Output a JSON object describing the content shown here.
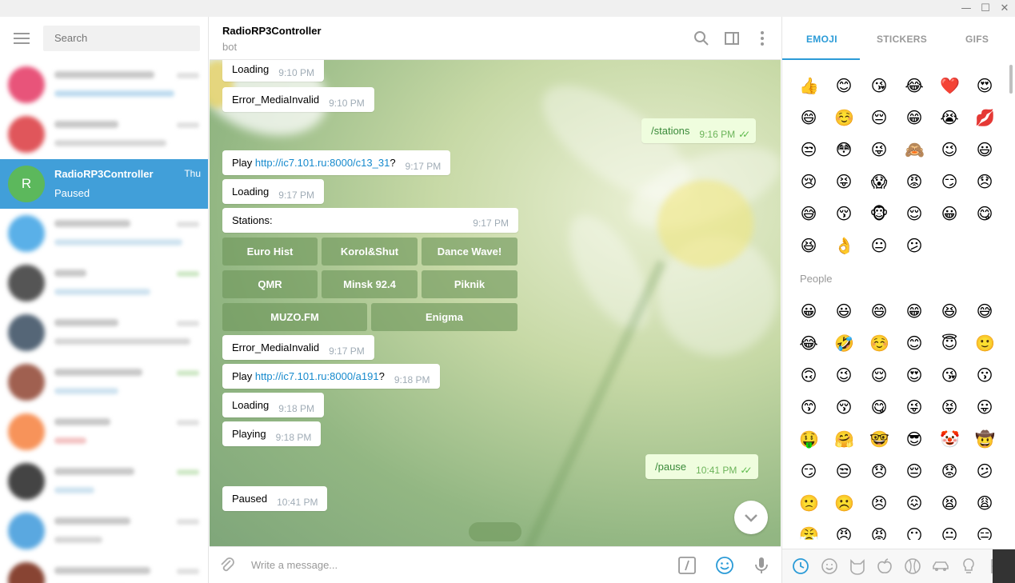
{
  "window": {
    "minimize": "—",
    "maximize": "☐",
    "close": "✕"
  },
  "sidebar": {
    "search_placeholder": "Search",
    "active_chat": {
      "avatar_letter": "R",
      "name": "RadioRP3Controller",
      "status": "Paused",
      "day": "Thu"
    },
    "blurred_avatar_colors": [
      "#e8547a",
      "#e0565b",
      "#5ab0e8",
      "#555555",
      "#556677",
      "#a06050",
      "#f7935a",
      "#444444",
      "#5aa8e0",
      "#884433"
    ]
  },
  "header": {
    "title": "RadioRP3Controller",
    "subtitle": "bot"
  },
  "messages": [
    {
      "text": "Loading",
      "time": "9:10 PM"
    },
    {
      "text": "Error_MediaInvalid",
      "time": "9:10 PM"
    },
    {
      "text": "/stations",
      "time": "9:16 PM",
      "outgoing": true
    },
    {
      "prefix": "Play ",
      "link": "http://ic7.101.ru:8000/c13_31",
      "suffix": "?",
      "time": "9:17 PM"
    },
    {
      "text": "Loading",
      "time": "9:17 PM"
    },
    {
      "text": "Stations:",
      "time": "9:17 PM"
    },
    {
      "text": "Error_MediaInvalid",
      "time": "9:17 PM"
    },
    {
      "prefix": "Play ",
      "link": "http://ic7.101.ru:8000/a191",
      "suffix": "?",
      "time": "9:18 PM"
    },
    {
      "text": "Loading",
      "time": "9:18 PM"
    },
    {
      "text": "Playing",
      "time": "9:18 PM"
    },
    {
      "text": "/pause",
      "time": "10:41 PM",
      "outgoing": true
    },
    {
      "text": "Paused",
      "time": "10:41 PM"
    }
  ],
  "keyboard": [
    "Euro Hist",
    "Korol&Shut",
    "Dance Wave!",
    "QMR",
    "Minsk 92.4",
    "Piknik",
    "MUZO.FM",
    "Enigma"
  ],
  "input": {
    "placeholder": "Write a message..."
  },
  "emoji_panel": {
    "tabs": [
      "EMOJI",
      "STICKERS",
      "GIFS"
    ],
    "active_tab": "EMOJI",
    "recent": [
      "👍",
      "😊",
      "😘",
      "😂",
      "❤️",
      "😍",
      "😄",
      "☺️",
      "😔",
      "😁",
      "😭",
      "💋",
      "😒",
      "😳",
      "😜",
      "🙈",
      "😉",
      "😃",
      "😢",
      "😝",
      "😱",
      "😡",
      "😏",
      "😞",
      "😅",
      "😚",
      "🐵",
      "😌",
      "😀",
      "😋",
      "😆",
      "👌",
      "😐",
      "😕"
    ],
    "people_title": "People",
    "people": [
      "😀",
      "😃",
      "😄",
      "😁",
      "😆",
      "😅",
      "😂",
      "🤣",
      "☺️",
      "😊",
      "😇",
      "🙂",
      "🙃",
      "😉",
      "😌",
      "😍",
      "😘",
      "😗",
      "😙",
      "😚",
      "😋",
      "😜",
      "😝",
      "😛",
      "🤑",
      "🤗",
      "🤓",
      "😎",
      "🤡",
      "🤠",
      "😏",
      "😒",
      "😞",
      "😔",
      "😟",
      "😕",
      "🙁",
      "☹️",
      "😣",
      "😖",
      "😫",
      "😩",
      "😤",
      "😠",
      "😡",
      "😶",
      "😐",
      "😑"
    ],
    "categories": [
      "clock-icon",
      "smiley-icon",
      "cat-icon",
      "apple-icon",
      "ball-icon",
      "car-icon",
      "bulb-icon",
      "flag-icon"
    ]
  },
  "colors": {
    "accent": "#419fd9",
    "link": "#168acd",
    "outgoing_bg": "#effdde",
    "keyboard_btn": "#6e965a"
  }
}
